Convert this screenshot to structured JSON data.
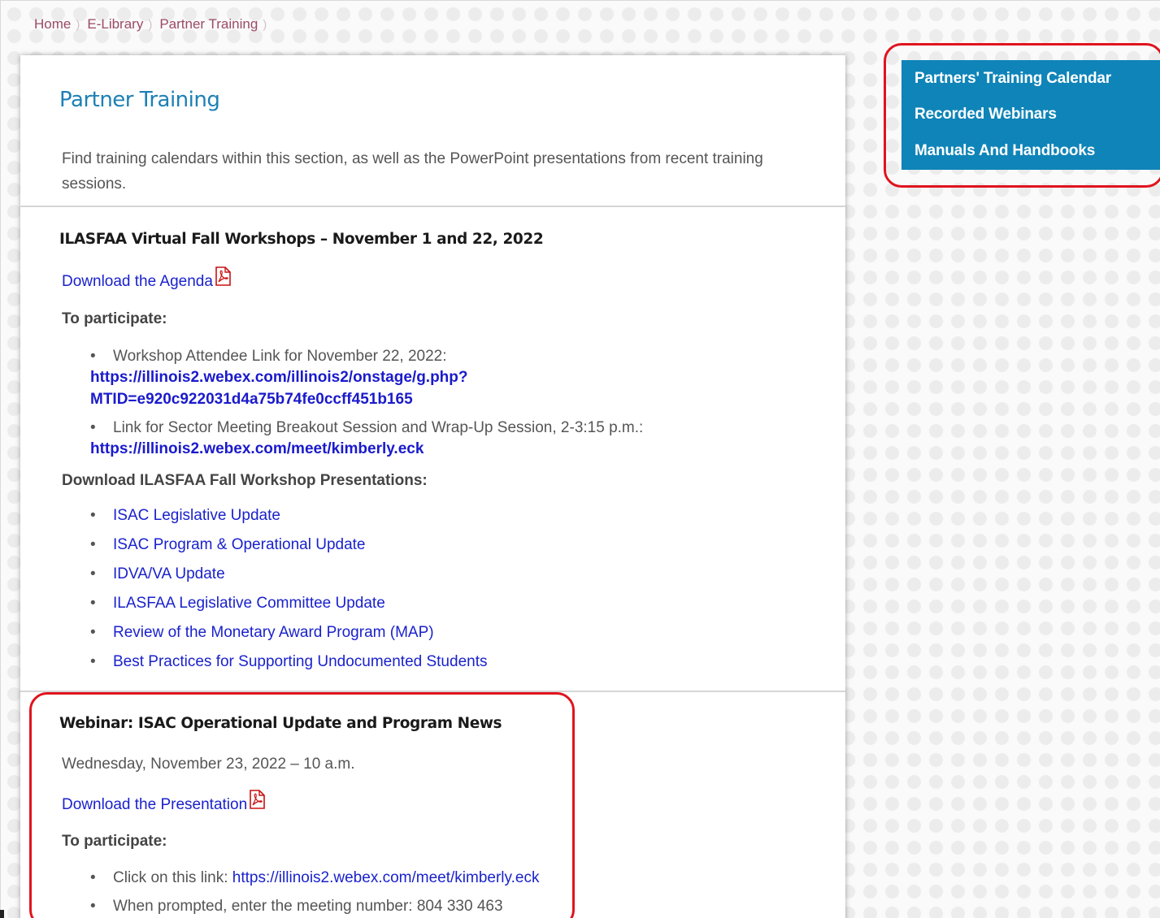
{
  "breadcrumb": {
    "items": [
      "Home",
      "E-Library",
      "Partner Training"
    ],
    "separator": ")"
  },
  "page": {
    "title": "Partner Training",
    "intro": "Find training calendars within this section, as well as the PowerPoint presentations from recent training sessions."
  },
  "sidebar": {
    "links": [
      "Partners' Training Calendar",
      "Recorded Webinars",
      "Manuals And Handbooks"
    ]
  },
  "workshop": {
    "title": "ILASFAA Virtual Fall Workshops – November 1 and 22, 2022",
    "agenda_link": "Download the Agenda",
    "participate_heading": "To participate:",
    "bullet1_text": "Workshop Attendee Link for November 22, 2022:",
    "bullet1_link_line1": "https://illinois2.webex.com/illinois2/onstage/g.php?",
    "bullet1_link_line2": "MTID=e920c922031d4a75b74fe0ccff451b165",
    "bullet2_text": "Link for Sector Meeting Breakout Session and Wrap-Up Session, 2-3:15 p.m.:",
    "bullet2_link": "https://illinois2.webex.com/meet/kimberly.eck",
    "presentations_heading": "Download ILASFAA Fall Workshop Presentations:",
    "presentations": [
      "ISAC Legislative Update",
      "ISAC Program & Operational Update",
      "IDVA/VA Update",
      "ILASFAA Legislative Committee Update",
      "Review of the Monetary Award Program (MAP)",
      "Best Practices for Supporting Undocumented Students"
    ]
  },
  "webinar": {
    "title": "Webinar: ISAC Operational Update and Program News",
    "date": "Wednesday, November 23, 2022 – 10 a.m.",
    "presentation_link": "Download the Presentation",
    "participate_heading": "To participate:",
    "bullet1_text": "Click on this link:",
    "bullet1_link": "https://illinois2.webex.com/meet/kimberly.eck",
    "bullet2_text": "When prompted, enter the meeting number: 804 330 463"
  },
  "icons": {
    "pdf": "pdf-icon",
    "bullet": "•"
  },
  "colors": {
    "title_blue": "#1d80b5",
    "sidebar_blue": "#0f84b8",
    "link_blue": "#1a22cc",
    "annotation_red": "#e0141e"
  }
}
